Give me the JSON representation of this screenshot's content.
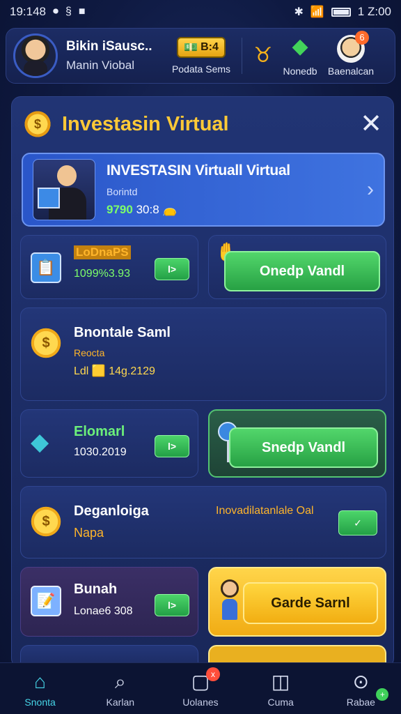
{
  "status_bar": {
    "time_left": "19:148",
    "time_right": "1 Z:00"
  },
  "header": {
    "user_name": "Bikin iSausc..",
    "user_sub": "Manin Viobal",
    "coin_value": "B:4",
    "coin_label": "Podata Sems",
    "icon1_label": "Nonedb",
    "icon2_label": "Baenalcan",
    "mini_notif": "6"
  },
  "panel": {
    "title": "Investasin Virtual",
    "feature": {
      "title": "INVESTASIN Virtuall Virtual",
      "subtitle": "Borintd",
      "value_green": "9790",
      "value_white": "30:8"
    },
    "cards": [
      {
        "name": "LoDnaPS",
        "value": "1099%3.93",
        "btn": "l>"
      },
      {
        "action": "Onedp Vandl"
      },
      {
        "name": "Bnontale Saml",
        "sub": "Reocta",
        "value_prefix": "Ldl",
        "value": "14g.2129"
      },
      {
        "name": "Elomarl",
        "value": "1030.2019",
        "btn": "l>"
      },
      {
        "action": "Snedp Vandl"
      },
      {
        "name": "Deganloiga",
        "sub": "Napa",
        "right_label": "Inovadilatanlale Oal"
      },
      {
        "name": "Bunah",
        "value": "Lonae6 308",
        "btn": "l>"
      },
      {
        "action": "Garde Sarnl"
      }
    ]
  },
  "nav": [
    {
      "label": "Snonta",
      "icon": "home-icon"
    },
    {
      "label": "Karlan",
      "icon": "search-icon"
    },
    {
      "label": "Uolanes",
      "icon": "inbox-icon",
      "badge": "x"
    },
    {
      "label": "Cuma",
      "icon": "wallet-icon"
    },
    {
      "label": "Rabae",
      "icon": "profile-search-icon",
      "badge": "+"
    }
  ]
}
